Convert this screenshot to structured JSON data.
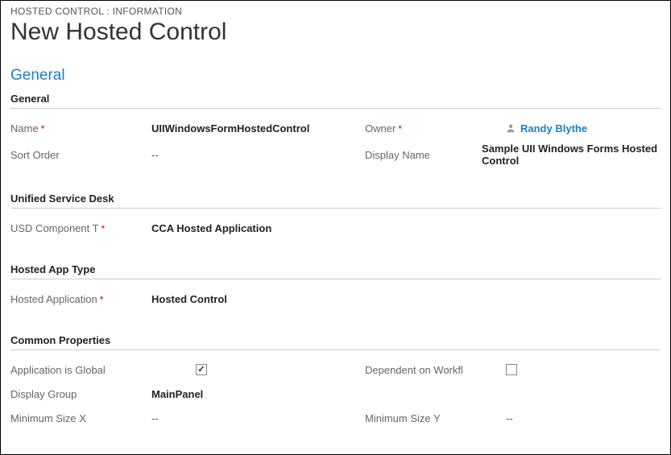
{
  "breadcrumb": "HOSTED CONTROL : INFORMATION",
  "page_title": "New Hosted Control",
  "tab": "General",
  "sections": {
    "general": {
      "heading": "General",
      "name_label": "Name",
      "name_value": "UIIWindowsFormHostedControl",
      "sort_order_label": "Sort Order",
      "sort_order_value": "--",
      "owner_label": "Owner",
      "owner_value": "Randy Blythe",
      "display_name_label": "Display Name",
      "display_name_value": "Sample UII Windows Forms Hosted Control"
    },
    "usd": {
      "heading": "Unified Service Desk",
      "component_label": "USD Component T",
      "component_value": "CCA Hosted Application"
    },
    "hosted_app": {
      "heading": "Hosted App Type",
      "label": "Hosted Application",
      "value": "Hosted Control"
    },
    "common": {
      "heading": "Common Properties",
      "global_label": "Application is Global",
      "global_checked": true,
      "workflow_label": "Dependent on Workfl",
      "workflow_checked": false,
      "display_group_label": "Display Group",
      "display_group_value": "MainPanel",
      "min_x_label": "Minimum Size X",
      "min_x_value": "--",
      "min_y_label": "Minimum Size Y",
      "min_y_value": "--"
    }
  }
}
